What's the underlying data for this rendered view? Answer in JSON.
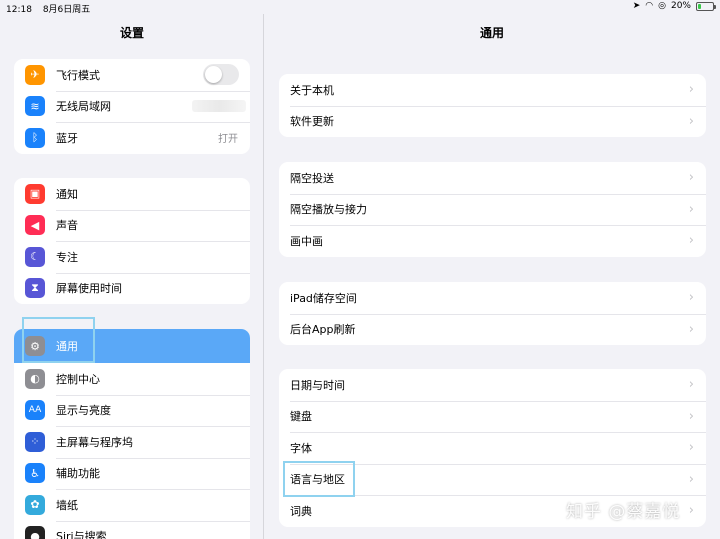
{
  "status_bar": {
    "time": "12:18",
    "date": "8月6日周五",
    "battery": "20%",
    "battery_level": 0.2
  },
  "sidebar": {
    "title": "设置",
    "groups": [
      [
        {
          "label": "飞行模式",
          "icon": "airplane-icon",
          "color": "#ff9500"
        },
        {
          "label": "无线局域网",
          "icon": "wifi-icon",
          "color": "#1a82fb"
        },
        {
          "label": "蓝牙",
          "icon": "bluetooth-icon",
          "color": "#1a82fb",
          "value": "打开"
        }
      ],
      [
        {
          "label": "通知",
          "icon": "notification-icon",
          "color": "#ff3b30"
        },
        {
          "label": "声音",
          "icon": "sound-icon",
          "color": "#ff2d55"
        },
        {
          "label": "专注",
          "icon": "moon-icon",
          "color": "#5856d6"
        },
        {
          "label": "屏幕使用时间",
          "icon": "hourglass-icon",
          "color": "#5856d6"
        }
      ],
      [
        {
          "label": "通用",
          "icon": "gear-icon",
          "color": "#8e8e93"
        },
        {
          "label": "控制中心",
          "icon": "toggles-icon",
          "color": "#8e8e93"
        },
        {
          "label": "显示与亮度",
          "icon": "text-size-icon",
          "color": "#1a82fb"
        },
        {
          "label": "主屏幕与程序坞",
          "icon": "home-grid-icon",
          "color": "#2f5ed7"
        },
        {
          "label": "辅助功能",
          "icon": "accessibility-icon",
          "color": "#1a82fb"
        },
        {
          "label": "墙纸",
          "icon": "wallpaper-icon",
          "color": "#34aadc"
        },
        {
          "label": "Siri与搜索",
          "icon": "siri-icon",
          "color": "#222222"
        }
      ]
    ],
    "airplane_mode_on": false
  },
  "main": {
    "title": "通用",
    "sections": [
      [
        "关于本机",
        "软件更新"
      ],
      [
        "隔空投送",
        "隔空播放与接力",
        "画中画"
      ],
      [
        "iPad储存空间",
        "后台App刷新"
      ],
      [
        "日期与时间",
        "键盘",
        "字体",
        "语言与地区",
        "词典"
      ]
    ]
  },
  "watermark": "知乎 @蔡嘉悦",
  "colors": {
    "selected": "#5aa8f7",
    "highlight": "#8fd2ef",
    "background": "#f2f2f7"
  }
}
